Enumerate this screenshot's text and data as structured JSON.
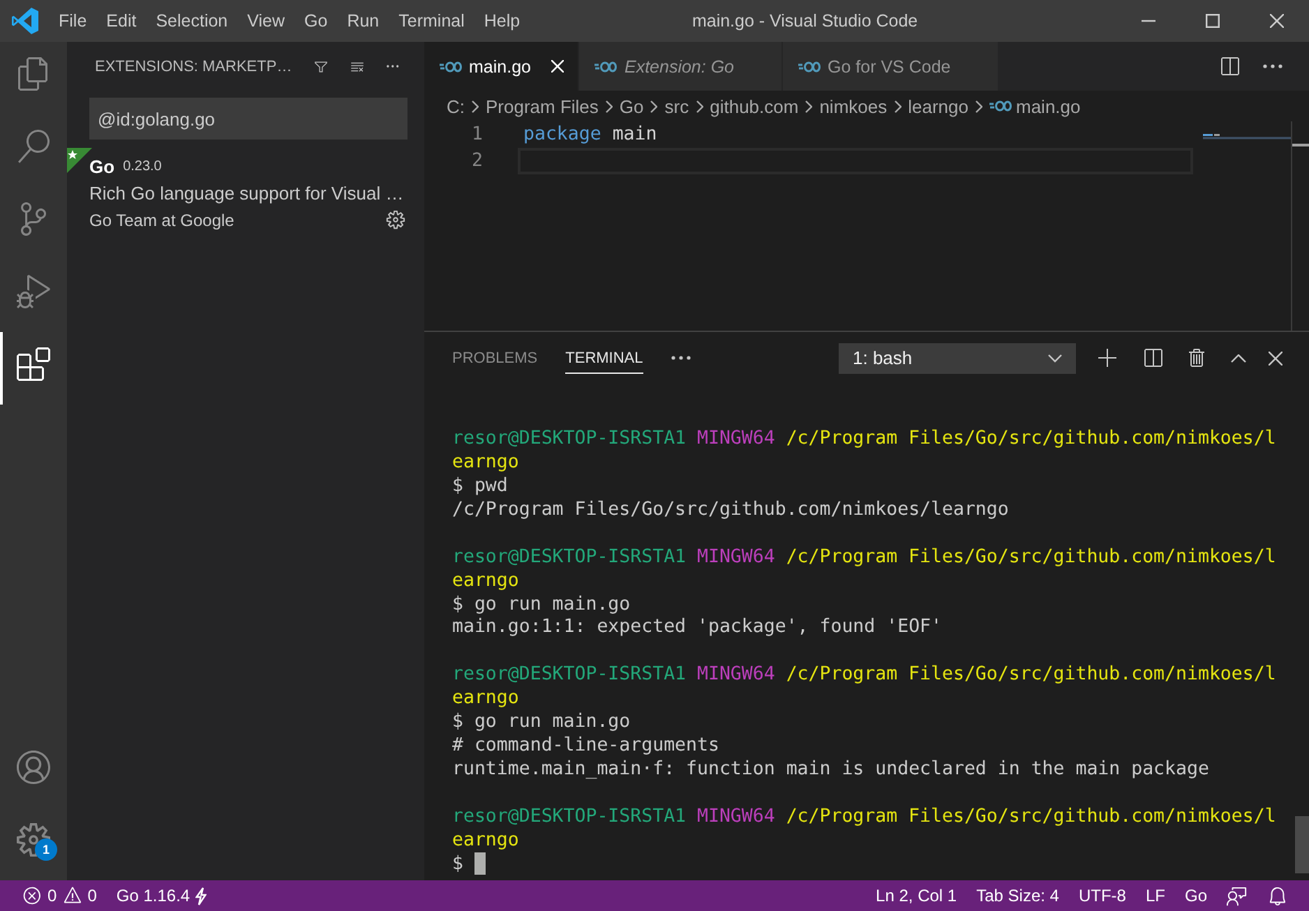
{
  "window": {
    "title": "main.go - Visual Studio Code"
  },
  "menu": [
    "File",
    "Edit",
    "Selection",
    "View",
    "Go",
    "Run",
    "Terminal",
    "Help"
  ],
  "activity_bar": {
    "items": [
      {
        "kind": "explorer",
        "selected": false
      },
      {
        "kind": "search",
        "selected": false
      },
      {
        "kind": "source-control",
        "selected": false
      },
      {
        "kind": "run",
        "selected": false
      },
      {
        "kind": "extensions",
        "selected": true
      }
    ],
    "bottom": [
      {
        "kind": "accounts"
      },
      {
        "kind": "manage",
        "badge": "1"
      }
    ]
  },
  "sidebar": {
    "title": "EXTENSIONS: MARKETP…",
    "search": {
      "value": "@id:golang.go"
    },
    "extensions": [
      {
        "name": "Go",
        "version": "0.23.0",
        "description": "Rich Go language support for Visual …",
        "publisher": "Go Team at Google",
        "recommended": true
      }
    ]
  },
  "editor": {
    "tabs": [
      {
        "label": "main.go",
        "selected": true,
        "preview": false
      },
      {
        "label": "Extension: Go",
        "selected": false,
        "preview": true
      },
      {
        "label": "Go for VS Code",
        "selected": false,
        "preview": false
      }
    ],
    "breadcrumbs": [
      {
        "kind": "folder",
        "label": "C:"
      },
      {
        "kind": "folder",
        "label": "Program Files"
      },
      {
        "kind": "folder",
        "label": "Go"
      },
      {
        "kind": "folder",
        "label": "src"
      },
      {
        "kind": "folder",
        "label": "github.com"
      },
      {
        "kind": "folder",
        "label": "nimkoes"
      },
      {
        "kind": "folder",
        "label": "learngo"
      },
      {
        "kind": "file",
        "label": "main.go"
      }
    ],
    "lines": [
      {
        "number": "1",
        "current": false,
        "tokens": [
          {
            "kind": "keyword",
            "text": "package"
          },
          {
            "kind": "identifier",
            "text": "main"
          }
        ]
      },
      {
        "number": "2",
        "current": true
      }
    ]
  },
  "panel": {
    "tabs": [
      {
        "label": "PROBLEMS",
        "selected": false
      },
      {
        "label": "TERMINAL",
        "selected": true
      }
    ],
    "terminal_select": {
      "value": "1: bash"
    },
    "terminal": {
      "lines": [
        {
          "kind": "prompt",
          "user": "resor@DESKTOP-ISRSTA1",
          "system": "MINGW64",
          "path": "/c/Program Files/Go/src/github.com/nimkoes/l"
        },
        {
          "kind": "path",
          "text": "earngo"
        },
        {
          "kind": "output",
          "text": "$ pwd"
        },
        {
          "kind": "output",
          "text": "/c/Program Files/Go/src/github.com/nimkoes/learngo"
        },
        {
          "kind": "blank"
        },
        {
          "kind": "prompt",
          "user": "resor@DESKTOP-ISRSTA1",
          "system": "MINGW64",
          "path": "/c/Program Files/Go/src/github.com/nimkoes/l"
        },
        {
          "kind": "path",
          "text": "earngo"
        },
        {
          "kind": "output",
          "text": "$ go run main.go"
        },
        {
          "kind": "output",
          "text": "main.go:1:1: expected 'package', found 'EOF'"
        },
        {
          "kind": "blank"
        },
        {
          "kind": "prompt",
          "user": "resor@DESKTOP-ISRSTA1",
          "system": "MINGW64",
          "path": "/c/Program Files/Go/src/github.com/nimkoes/l"
        },
        {
          "kind": "path",
          "text": "earngo"
        },
        {
          "kind": "output",
          "text": "$ go run main.go"
        },
        {
          "kind": "output",
          "text": "# command-line-arguments"
        },
        {
          "kind": "output",
          "text": "runtime.main_main·f: function main is undeclared in the main package"
        },
        {
          "kind": "blank"
        },
        {
          "kind": "prompt",
          "user": "resor@DESKTOP-ISRSTA1",
          "system": "MINGW64",
          "path": "/c/Program Files/Go/src/github.com/nimkoes/l"
        },
        {
          "kind": "path",
          "text": "earngo"
        },
        {
          "kind": "cursor",
          "text": "$"
        }
      ]
    }
  },
  "status_bar": {
    "errors": "0",
    "warnings": "0",
    "go_version": "Go 1.16.4",
    "items": [
      "Ln 2, Col 1",
      "Tab Size: 4",
      "UTF-8",
      "LF",
      "Go"
    ]
  }
}
